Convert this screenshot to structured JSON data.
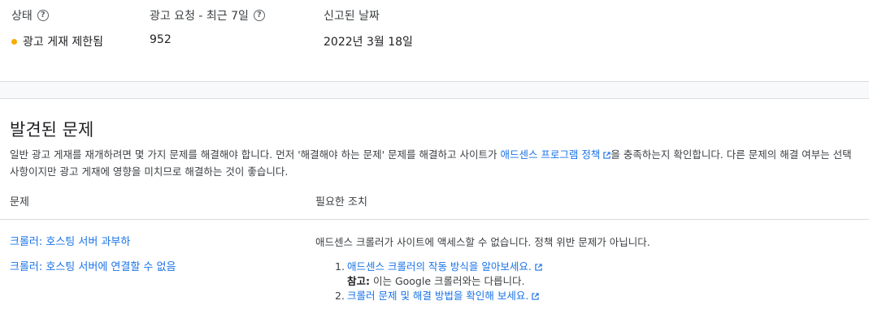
{
  "summary": {
    "status_label": "상태",
    "requests_label": "광고 요청 - 최근 7일",
    "reported_label": "신고된 날짜",
    "status_value": "광고 게재 제한됨",
    "requests_value": "952",
    "reported_value": "2022년 3월 18일",
    "status_color": "#f9ab00"
  },
  "issues_section": {
    "title": "발견된 문제",
    "desc_before": "일반 광고 게재를 재개하려면 몇 가지 문제를 해결해야 합니다. 먼저 '해결해야 하는 문제' 문제를 해결하고 사이트가 ",
    "desc_link": "애드센스 프로그램 정책",
    "desc_after": "을 충족하는지 확인합니다. 다른 문제의 해결 여부는 선택사항이지만 광고 게재에 영향을 미치므로 해결하는 것이 좋습니다.",
    "col_issue": "문제",
    "col_action": "필요한 조치",
    "issues": [
      "크롤러: 호스팅 서버 과부하",
      "크롤러: 호스팅 서버에 연결할 수 없음"
    ],
    "action_text": "애드센스 크롤러가 사이트에 액세스할 수 없습니다. 정책 위반 문제가 아닙니다.",
    "steps": [
      {
        "num": "1.",
        "link": "애드센스 크롤러의 작동 방식을 알아보세요."
      },
      {
        "num": "2.",
        "link": "크롤러 문제 및 해결 방법을 확인해 보세요."
      }
    ],
    "note_label": "참고:",
    "note_text": " 이는 Google 크롤러와는 다릅니다."
  },
  "icons": {
    "help": "help-circle-icon",
    "external": "open-in-new-icon",
    "status_dot": "status-dot-icon"
  }
}
